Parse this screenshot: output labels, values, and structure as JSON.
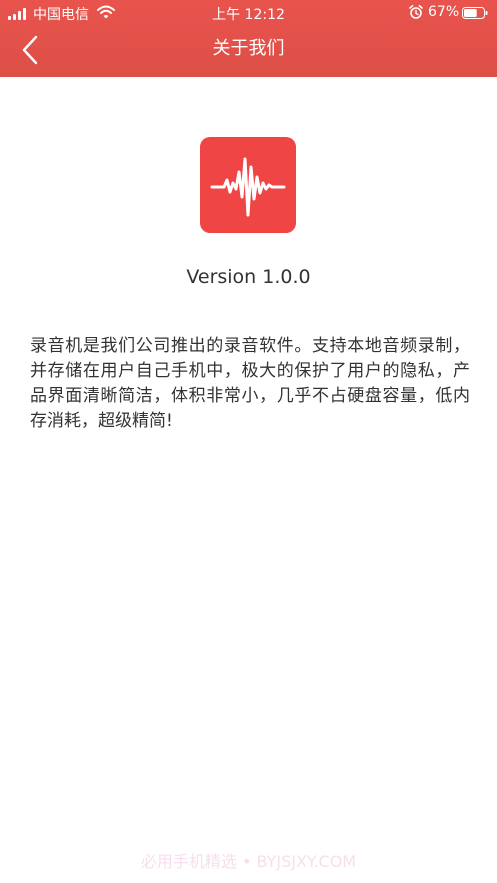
{
  "status_bar": {
    "carrier": "中国电信",
    "time": "上午 12:12",
    "battery": "67%",
    "battery_level": 0.67,
    "icons": [
      "signal-icon",
      "wifi-icon",
      "alarm-icon",
      "battery-icon"
    ]
  },
  "nav": {
    "title": "关于我们",
    "back_icon": "chevron-left-icon"
  },
  "app": {
    "icon": "waveform-icon",
    "version": "Version 1.0.0",
    "description": "录音机是我们公司推出的录音软件。支持本地音频录制，并存储在用户自己手机中，极大的保护了用户的隐私，产品界面清晰简洁，体积非常小，几乎不占硬盘容量，低内存消耗，超级精简!"
  },
  "watermark": "必用手机精选 • BYJSJXY.COM",
  "colors": {
    "header": "#e2514a",
    "icon_bg": "#ef4545",
    "text": "#333333",
    "white": "#ffffff"
  }
}
